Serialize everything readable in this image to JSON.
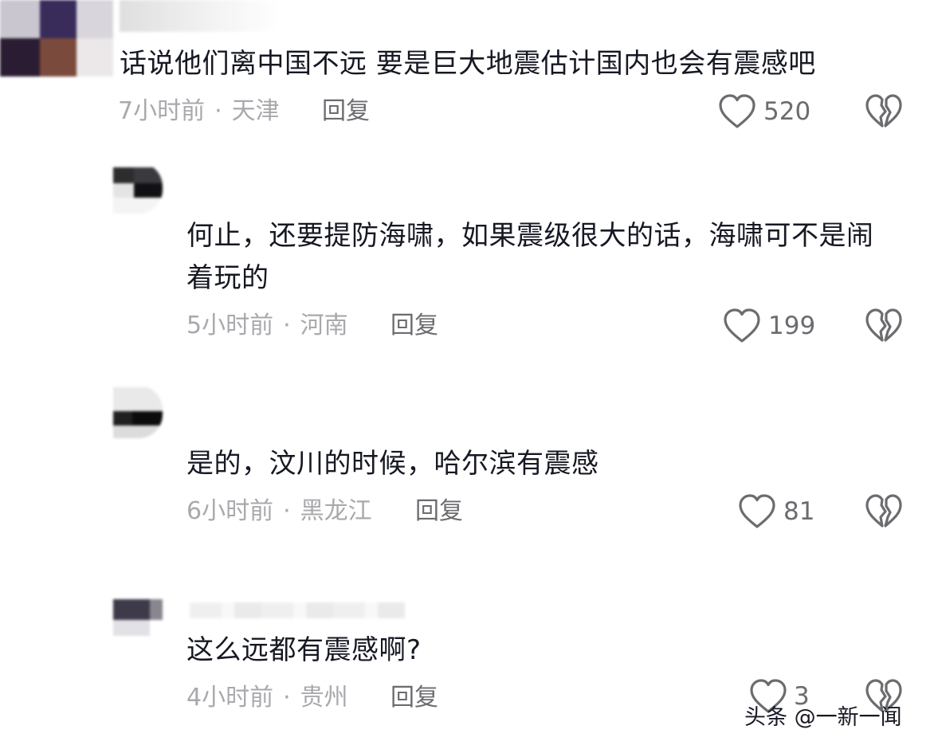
{
  "comments": [
    {
      "text": "话说他们离中国不远 要是巨大地震估计国内也会有震感吧",
      "time": "7小时前",
      "location": "天津",
      "separator": "·",
      "reply_label": "回复",
      "like_count": "520"
    },
    {
      "text_line1": "何止，还要提防海啸，如果震级很大的话，海啸可不是闹",
      "text_line2": "着玩的",
      "time": "5小时前",
      "location": "河南",
      "separator": "·",
      "reply_label": "回复",
      "like_count": "199"
    },
    {
      "text": "是的，汶川的时候，哈尔滨有震感",
      "time": "6小时前",
      "location": "黑龙江",
      "separator": "·",
      "reply_label": "回复",
      "like_count": "81"
    },
    {
      "text": "这么远都有震感啊?",
      "time": "4小时前",
      "location": "贵州",
      "separator": "·",
      "reply_label": "回复",
      "like_count": "3"
    }
  ],
  "watermark": "头条 @一新一闻",
  "icons": {
    "like": "heart-outline-icon",
    "dislike": "broken-heart-icon"
  },
  "colors": {
    "text": "#161823",
    "meta": "#a8a9ad",
    "icon": "#6b6c70"
  }
}
